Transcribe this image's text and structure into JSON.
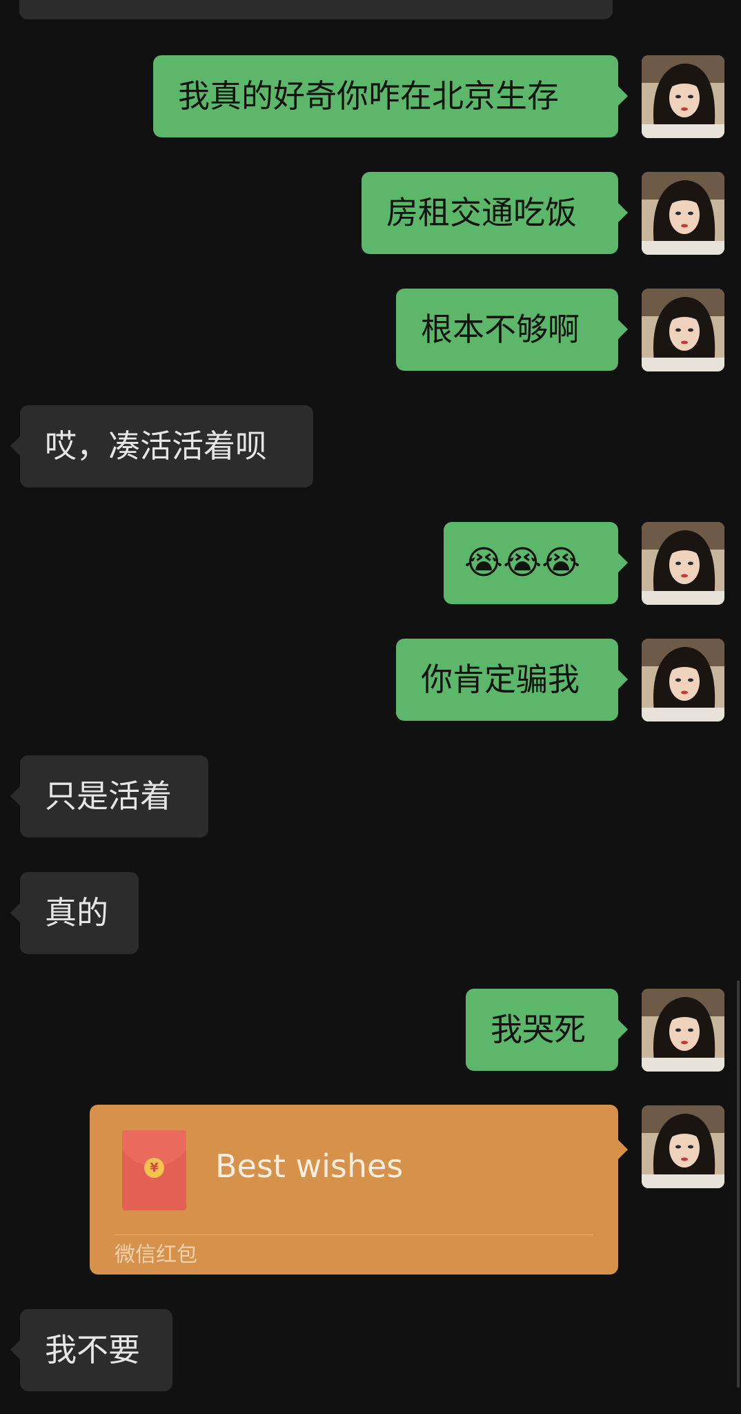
{
  "messages": [
    {
      "side": "out",
      "text": "我真的好奇你咋在北京生存"
    },
    {
      "side": "out",
      "text": "房租交通吃饭"
    },
    {
      "side": "out",
      "text": "根本不够啊"
    },
    {
      "side": "in",
      "text": "哎，凑活活着呗"
    },
    {
      "side": "out",
      "text": "😭😭😭"
    },
    {
      "side": "out",
      "text": "你肯定骗我"
    },
    {
      "side": "in",
      "text": "只是活着"
    },
    {
      "side": "in",
      "text": "真的"
    },
    {
      "side": "out",
      "text": "我哭死"
    },
    {
      "side": "in",
      "text": "我不要"
    }
  ],
  "red_packet": {
    "title": "Best wishes",
    "footer": "微信红包",
    "coin_symbol": "¥"
  },
  "colors": {
    "background": "#111111",
    "outgoing_bubble": "#5cb76a",
    "incoming_bubble": "#2c2c2c",
    "red_packet": "#d6924a"
  },
  "icons": {
    "avatar": "user-avatar-portrait"
  }
}
